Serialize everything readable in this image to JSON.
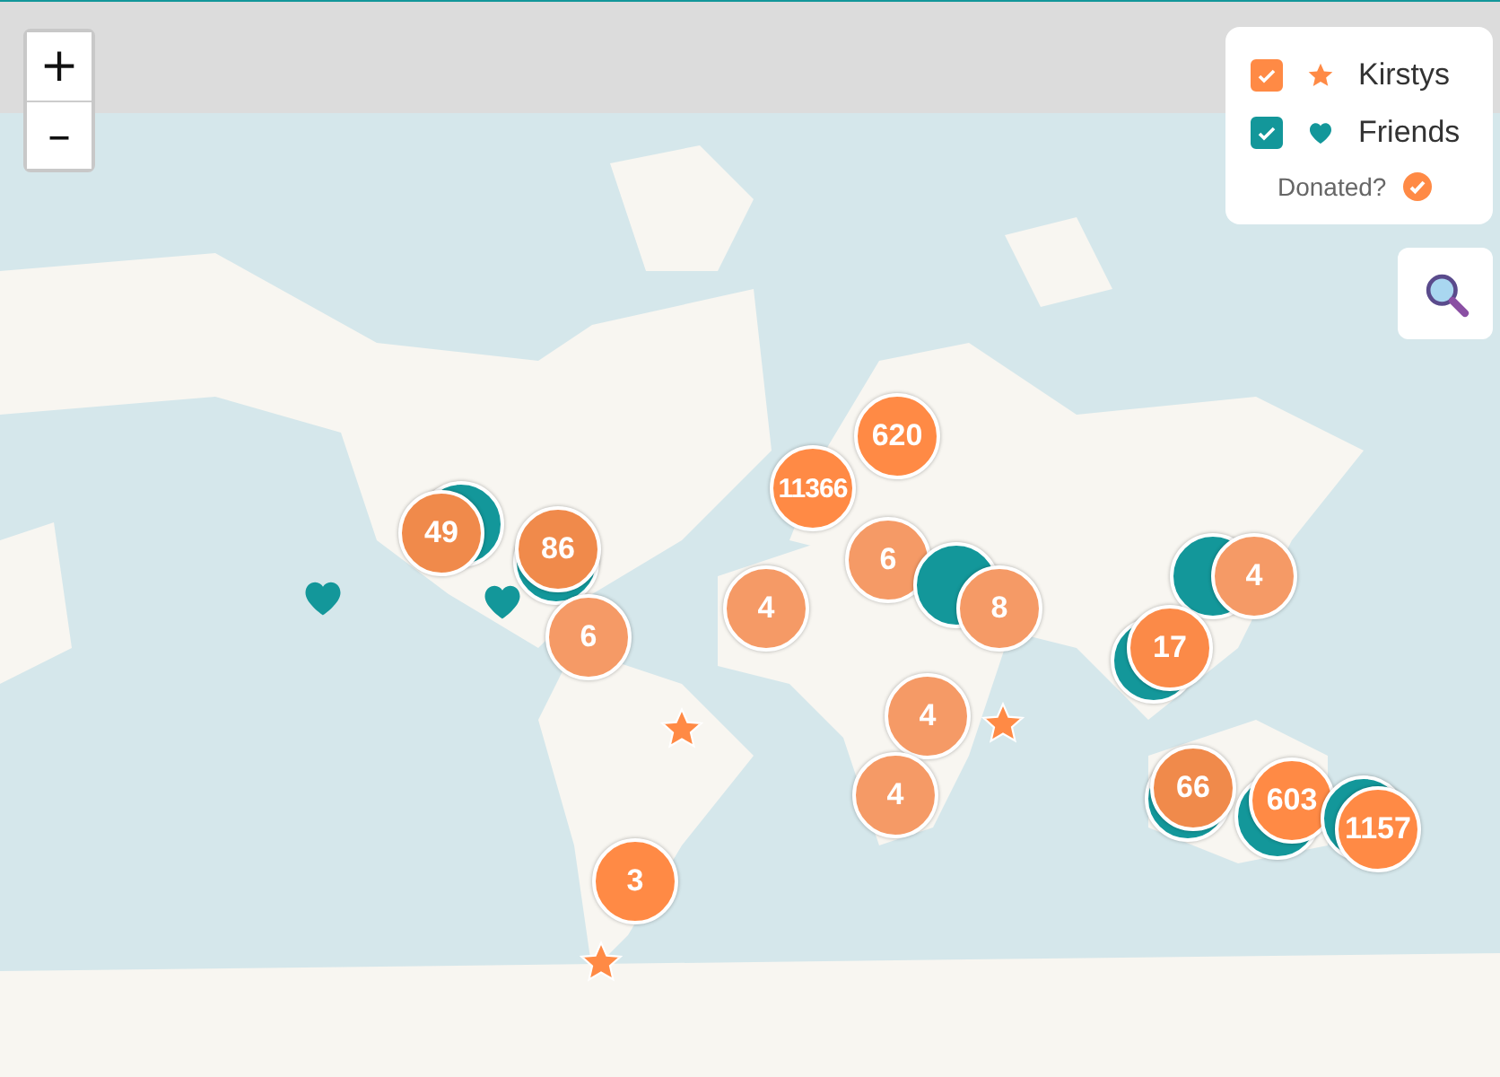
{
  "zoom_controls": [
    {
      "label": "+"
    },
    {
      "label": "–"
    }
  ],
  "legend": {
    "layers": [
      {
        "label": "Kirstys",
        "checked": true,
        "kind": "star",
        "color": "#ff8a45"
      },
      {
        "label": "Friends",
        "checked": true,
        "kind": "heart",
        "color": "#13979a"
      }
    ],
    "donated": {
      "label": "Donated?",
      "checked": true
    }
  },
  "markers": [
    {
      "kind": "stack",
      "count": "49",
      "color": "#f08a4b",
      "under": {
        "color": "#13979a"
      }
    },
    {
      "kind": "stack",
      "count": "86",
      "color": "#f08a4b",
      "under": {
        "color": "#13979a"
      }
    },
    {
      "kind": "heart",
      "color": "#13979a"
    },
    {
      "kind": "heart",
      "color": "#13979a"
    },
    {
      "kind": "cluster",
      "count": "6",
      "color": "#f59a66"
    },
    {
      "kind": "star",
      "color": "#ff8a45"
    },
    {
      "kind": "star",
      "color": "#ff8a45"
    },
    {
      "kind": "star",
      "color": "#ff8a45"
    },
    {
      "kind": "cluster",
      "count": "11366",
      "color": "#ff8a45"
    },
    {
      "kind": "cluster",
      "count": "620",
      "color": "#ff8a45"
    },
    {
      "kind": "cluster",
      "count": "4",
      "color": "#f59a66"
    },
    {
      "kind": "cluster",
      "count": "6",
      "color": "#f59a66"
    },
    {
      "kind": "stack",
      "count": "8",
      "color": "#f59a66",
      "under": {
        "color": "#13979a"
      }
    },
    {
      "kind": "cluster",
      "count": "4",
      "color": "#f59a66"
    },
    {
      "kind": "cluster",
      "count": "4",
      "color": "#f59a66"
    },
    {
      "kind": "cluster",
      "count": "3",
      "color": "#ff8a45"
    },
    {
      "kind": "stack",
      "count": "4",
      "color": "#f59a66",
      "under": {
        "color": "#13979a"
      }
    },
    {
      "kind": "stack",
      "count": "17",
      "color": "#fb8a48",
      "under": {
        "color": "#13979a"
      }
    },
    {
      "kind": "stack",
      "count": "66",
      "color": "#f08a4b",
      "under": {
        "color": "#13979a"
      }
    },
    {
      "kind": "stack",
      "count": "603",
      "color": "#ff8a45",
      "under": {
        "color": "#13979a"
      }
    },
    {
      "kind": "stack",
      "count": "1157",
      "color": "#ff8a45",
      "under": {
        "color": "#13979a"
      }
    }
  ]
}
